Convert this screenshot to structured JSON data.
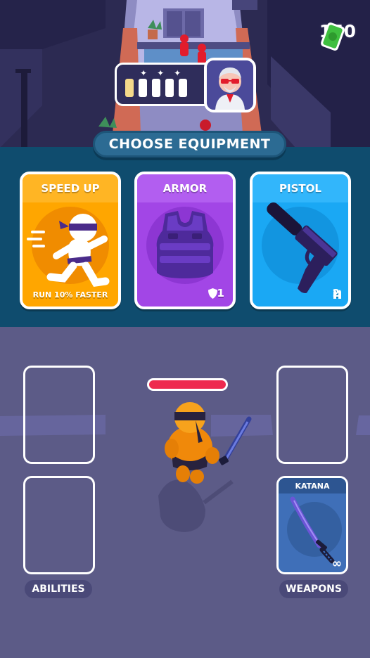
{
  "currency": {
    "amount": "150",
    "icon": "cash-icon",
    "color": "#3fbf3f"
  },
  "level_progress": {
    "stages_total": 5,
    "stages_completed": 1,
    "skull_icon": "skull-icon",
    "boss_icon": "boss-portrait-icon"
  },
  "equipment": {
    "title": "CHOOSE EQUIPMENT",
    "cards": [
      {
        "title": "SPEED UP",
        "footer": "RUN 10% FASTER",
        "icon": "running-ninja-icon",
        "color": "#ffa600"
      },
      {
        "title": "ARMOR",
        "footer": "+1",
        "footer_icon": "shield-icon",
        "icon": "armor-vest-icon",
        "color": "#a246e6"
      },
      {
        "title": "PISTOL",
        "footer": "2",
        "footer_icon": "bullets-icon",
        "icon": "silenced-pistol-icon",
        "color": "#1aa8f4"
      }
    ]
  },
  "player": {
    "health_fraction": 1.0,
    "health_color": "#ee2a4f"
  },
  "slots": {
    "abilities_label": "ABILITIES",
    "weapons_label": "WEAPONS",
    "weapon_equipped": {
      "name": "KATANA",
      "ammo": "∞",
      "icon": "katana-icon"
    }
  }
}
